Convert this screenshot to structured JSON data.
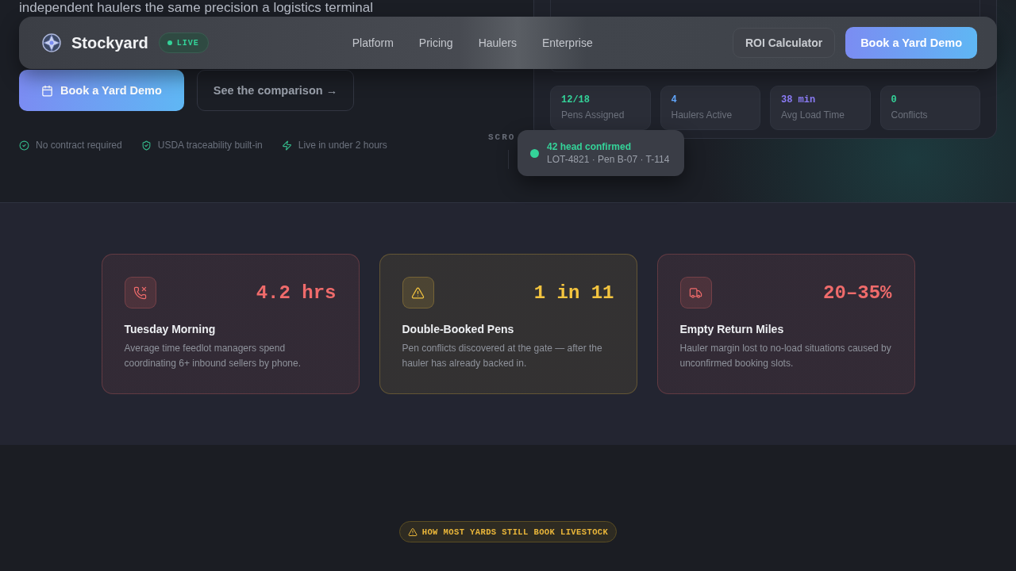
{
  "hero": {
    "intro_line": "independent haulers the same precision a logistics terminal",
    "primary_button": "Book a Yard Demo",
    "secondary_button": "See the comparison →",
    "assurances": [
      {
        "kind": "check",
        "label": "No contract required"
      },
      {
        "kind": "shield",
        "label": "USDA traceability built-in"
      },
      {
        "kind": "bolt",
        "label": "Live in under 2 hours"
      }
    ],
    "scroll_hint": "SCRO"
  },
  "nav": {
    "brand": "Stockyard",
    "badge": "LIVE",
    "links": [
      "Platform",
      "Pricing",
      "Haulers",
      "Enterprise"
    ],
    "secondary_button": "ROI Calculator",
    "primary_button": "Book a Yard Demo"
  },
  "dashboard": {
    "stats": [
      {
        "value": "12/18",
        "label": "Pens Assigned",
        "color": "#34d399"
      },
      {
        "value": "4",
        "label": "Haulers Active",
        "color": "#60a5fa"
      },
      {
        "value": "38 min",
        "label": "Avg Load Time",
        "color": "#8b7cf6"
      },
      {
        "value": "0",
        "label": "Conflicts",
        "color": "#34d399"
      }
    ],
    "toast": {
      "title": "42 head confirmed",
      "detail": "LOT-4821 · Pen B-07 · T-114"
    }
  },
  "problems": [
    {
      "kind": "phone",
      "color": "#ef6b6b",
      "value": "4.2 hrs",
      "title": "Tuesday Morning",
      "text": "Average time feedlot managers spend coordinating 6+ inbound sellers by phone."
    },
    {
      "kind": "warning",
      "color": "#f3c43f",
      "value": "1 in 11",
      "title": "Double-Booked Pens",
      "text": "Pen conflicts discovered at the gate — after the hauler has already backed in."
    },
    {
      "kind": "truck",
      "color": "#ef6b6b",
      "value": "20–35%",
      "title": "Empty Return Miles",
      "text": "Hauler margin lost to no-load situations caused by unconfirmed booking slots."
    }
  ],
  "next_section": {
    "eyebrow": "HOW MOST YARDS STILL BOOK LIVESTOCK"
  }
}
